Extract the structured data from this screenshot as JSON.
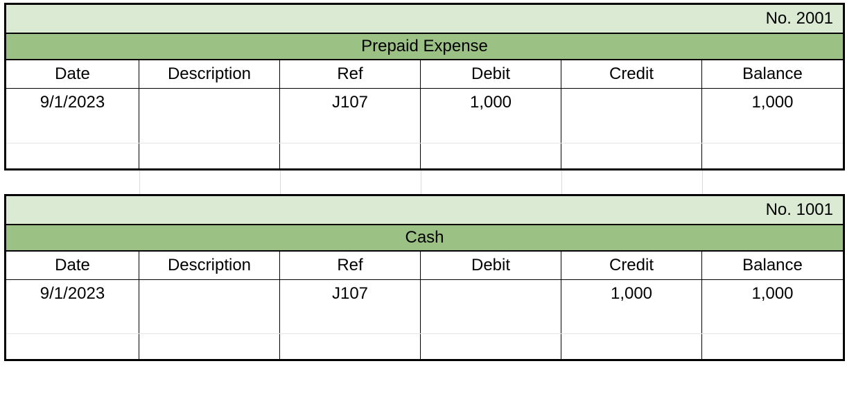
{
  "columns": {
    "date": "Date",
    "description": "Description",
    "ref": "Ref",
    "debit": "Debit",
    "credit": "Credit",
    "balance": "Balance"
  },
  "ledgers": [
    {
      "account_no_label": "No. 2001",
      "account_name": "Prepaid Expense",
      "rows": [
        {
          "date": "9/1/2023",
          "description": "",
          "ref": "J107",
          "debit": "1,000",
          "credit": "",
          "balance": "1,000"
        }
      ]
    },
    {
      "account_no_label": "No. 1001",
      "account_name": "Cash",
      "rows": [
        {
          "date": "9/1/2023",
          "description": "",
          "ref": "J107",
          "debit": "",
          "credit": "1,000",
          "balance": "1,000"
        }
      ]
    }
  ]
}
